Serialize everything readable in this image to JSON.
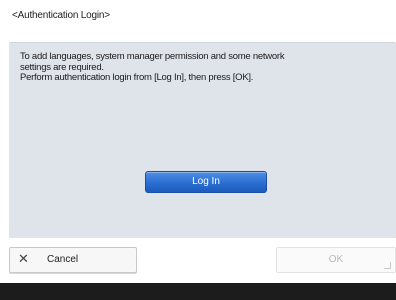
{
  "screen": {
    "title": "<Authentication Login>"
  },
  "message": {
    "lines": [
      "To add languages, system manager permission and some network",
      "settings are required.",
      "Perform authentication login from [Log In], then press [OK]."
    ]
  },
  "buttons": {
    "login_label": "Log In",
    "cancel_label": "Cancel",
    "ok_label": "OK"
  },
  "icons": {
    "cancel": "close-icon",
    "ok_corner": "corner-indicator-icon"
  },
  "colors": {
    "panel": "#dfe3ea",
    "login_button": "#2b6ed1",
    "status_bar": "#1c1c1c"
  }
}
